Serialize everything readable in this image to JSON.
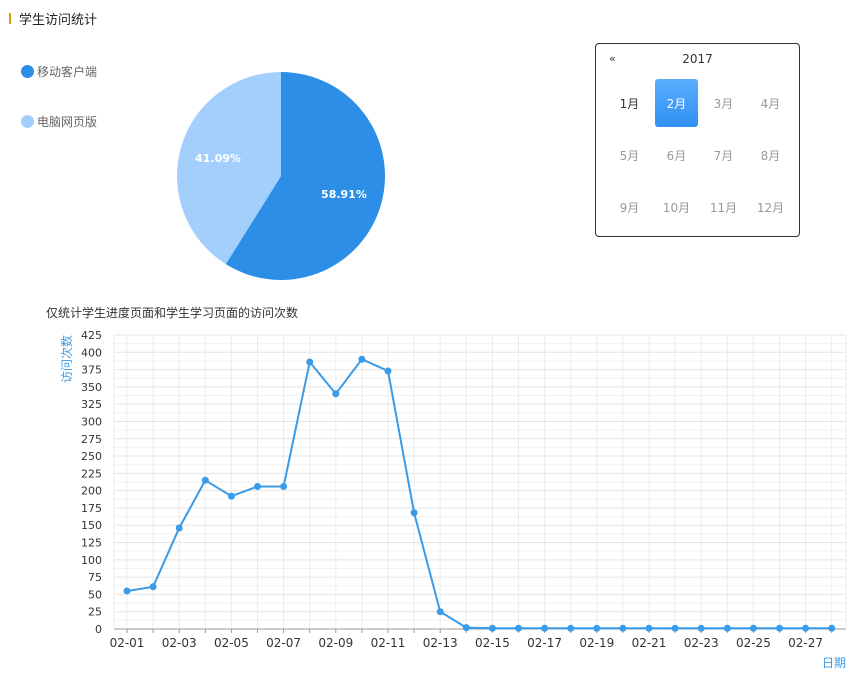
{
  "section_title": "学生访问统计",
  "pie": {
    "legend": [
      {
        "label": "移动客户端",
        "color": "#2d8ee8"
      },
      {
        "label": "电脑网页版",
        "color": "#a2cffc"
      }
    ],
    "chart_data": {
      "type": "pie",
      "slices": [
        {
          "label": "移动客户端",
          "value": 58.91,
          "text": "58.91%",
          "color": "#2d8ee8"
        },
        {
          "label": "电脑网页版",
          "value": 41.09,
          "text": "41.09%",
          "color": "#a2cffc"
        }
      ]
    }
  },
  "calendar": {
    "prev": "«",
    "year": "2017",
    "months": [
      "1月",
      "2月",
      "3月",
      "4月",
      "5月",
      "6月",
      "7月",
      "8月",
      "9月",
      "10月",
      "11月",
      "12月"
    ],
    "current_month": "1月",
    "selected_month": "2月"
  },
  "line": {
    "title": "仅统计学生进度页面和学生学习页面的访问次数",
    "chart_data": {
      "type": "line",
      "ylabel": "访问次数",
      "xlabel": "日期",
      "ylim": [
        0,
        425
      ],
      "yticks": [
        0,
        25,
        50,
        75,
        100,
        125,
        150,
        175,
        200,
        225,
        250,
        275,
        300,
        325,
        350,
        375,
        400,
        425
      ],
      "x": [
        "02-01",
        "02-02",
        "02-03",
        "02-04",
        "02-05",
        "02-06",
        "02-07",
        "02-08",
        "02-09",
        "02-10",
        "02-11",
        "02-12",
        "02-13",
        "02-14",
        "02-15",
        "02-16",
        "02-17",
        "02-18",
        "02-19",
        "02-20",
        "02-21",
        "02-22",
        "02-23",
        "02-24",
        "02-25",
        "02-26",
        "02-27",
        "02-28"
      ],
      "xtick_labels": [
        "02-01",
        "02-03",
        "02-05",
        "02-07",
        "02-09",
        "02-11",
        "02-13",
        "02-15",
        "02-17",
        "02-19",
        "02-21",
        "02-23",
        "02-25",
        "02-27"
      ],
      "series": [
        {
          "color": "#3a9be8",
          "values": [
            55,
            61,
            146,
            215,
            192,
            206,
            206,
            386,
            340,
            390,
            373,
            168,
            25,
            2,
            1,
            1,
            1,
            1,
            1,
            1,
            1,
            1,
            1,
            1,
            1,
            1,
            1,
            1
          ]
        }
      ],
      "grid": true
    }
  }
}
